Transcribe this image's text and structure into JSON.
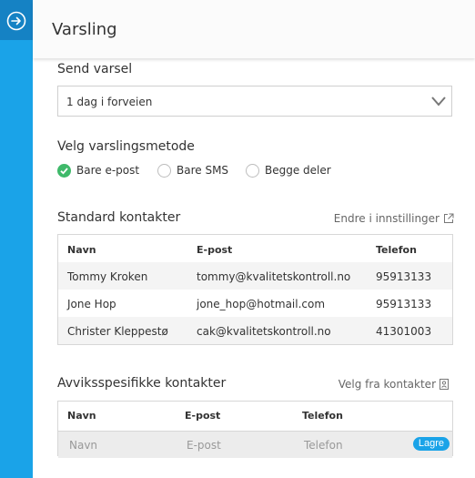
{
  "header": {
    "title": "Varsling"
  },
  "send": {
    "label": "Send varsel",
    "selected": "1 dag i forveien"
  },
  "method": {
    "label": "Velg varslingsmetode",
    "options": [
      {
        "label": "Bare e-post",
        "checked": true
      },
      {
        "label": "Bare SMS",
        "checked": false
      },
      {
        "label": "Begge deler",
        "checked": false
      }
    ]
  },
  "standard": {
    "title": "Standard kontakter",
    "link": "Endre i innstillinger",
    "columns": [
      "Navn",
      "E-post",
      "Telefon"
    ],
    "rows": [
      {
        "name": "Tommy Kroken",
        "email": "tommy@kvalitetskontroll.no",
        "phone": "95913133"
      },
      {
        "name": "Jone Hop",
        "email": "jone_hop@hotmail.com",
        "phone": "95913133"
      },
      {
        "name": "Christer Kleppestø",
        "email": "cak@kvalitetskontroll.no",
        "phone": "41301003"
      }
    ]
  },
  "specific": {
    "title": "Avviksspesifikke kontakter",
    "link": "Velg fra kontakter",
    "columns": [
      "Navn",
      "E-post",
      "Telefon"
    ],
    "placeholders": {
      "name": "Navn",
      "email": "E-post",
      "phone": "Telefon"
    },
    "save_label": "Lagre"
  },
  "colors": {
    "sidebar": "#1aa3e8",
    "sidebar_top": "#1582c4",
    "check": "#3fb96a"
  }
}
